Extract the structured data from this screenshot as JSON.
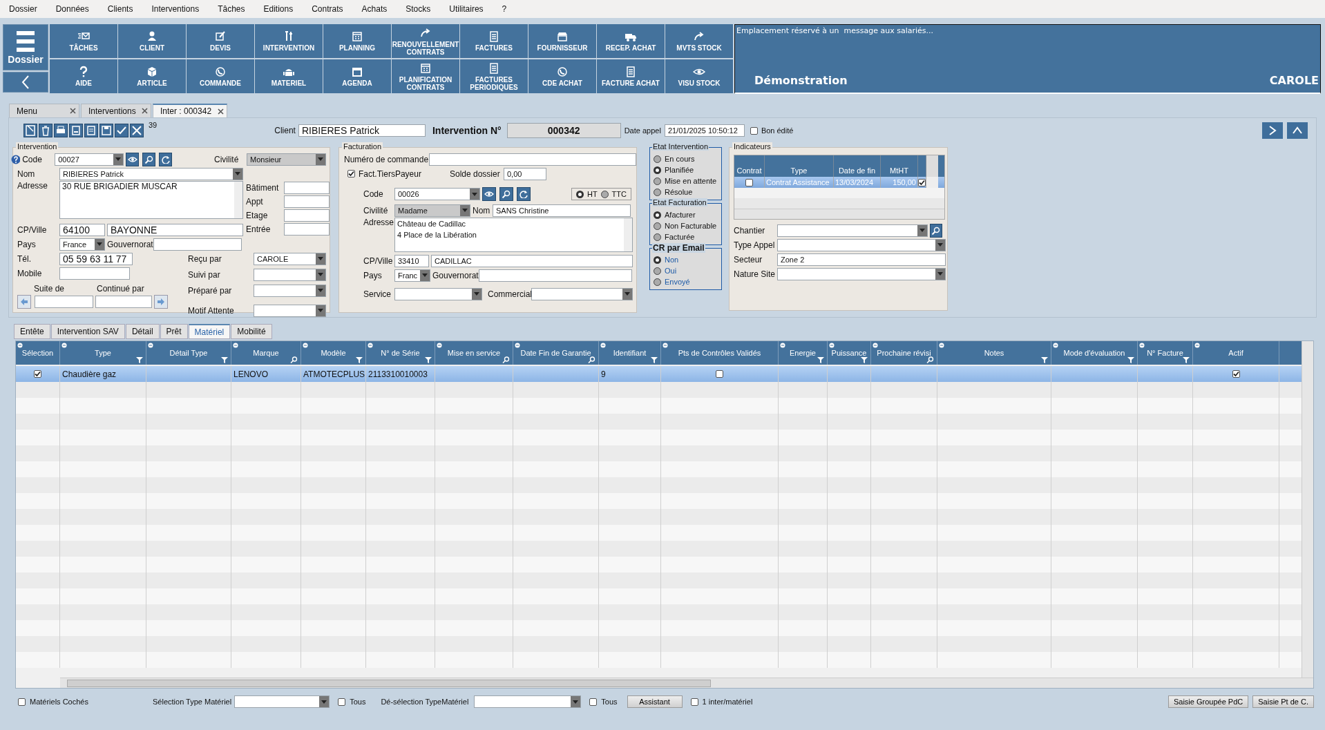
{
  "menu": [
    "Dossier",
    "Données",
    "Clients",
    "Interventions",
    "Tâches",
    "Editions",
    "Contrats",
    "Achats",
    "Stocks",
    "Utilitaires",
    "?"
  ],
  "toolbar": {
    "dossier": "Dossier",
    "rows": [
      [
        "TÂCHES",
        "CLIENT",
        "DEVIS",
        "INTERVENTION",
        "PLANNING",
        "RENOUVELLEMENT CONTRATS",
        "FACTURES",
        "FOURNISSEUR",
        "RECEP. ACHAT",
        "MVTS STOCK"
      ],
      [
        "AIDE",
        "ARTICLE",
        "COMMANDE",
        "MATERIEL",
        "AGENDA",
        "PLANIFICATION CONTRATS",
        "FACTURES PERIODIQUES",
        "CDE ACHAT",
        "FACTURE ACHAT",
        "VISU STOCK"
      ]
    ]
  },
  "message": {
    "text": "Emplacement réservé à un  message aux salariés...",
    "company": "Démonstration",
    "user": "CAROLE"
  },
  "doc_tabs": [
    {
      "label": "Menu",
      "selected": false
    },
    {
      "label": "Interventions",
      "selected": false
    },
    {
      "label": "Inter : 000342",
      "selected": true
    }
  ],
  "header": {
    "record_count": "39",
    "client_label": "Client",
    "client": "RIBIERES Patrick",
    "number_label": "Intervention N°",
    "number": "000342",
    "date_label": "Date appel",
    "date": "21/01/2025 10:50:12",
    "bon_edite": {
      "label": "Bon édité",
      "checked": false
    }
  },
  "intervention": {
    "title": "Intervention",
    "code_label": "Code",
    "code": "00027",
    "civilite_label": "Civilité",
    "civilite": "Monsieur",
    "nom_label": "Nom",
    "nom": "RIBIERES Patrick",
    "adresse_label": "Adresse",
    "adresse": "30 RUE BRIGADIER MUSCAR",
    "extra": [
      {
        "label": "Bâtiment"
      },
      {
        "label": "Appt"
      },
      {
        "label": "Etage"
      },
      {
        "label": "Entrée"
      }
    ],
    "cp_label": "CP/Ville",
    "cp": "64100",
    "ville": "BAYONNE",
    "pays_label": "Pays",
    "pays": "France",
    "gouvernorat_label": "Gouvernorat",
    "tel_label": "Tél.",
    "tel": "05 59 63 11 77",
    "mobile_label": "Mobile",
    "suite_label": "Suite de",
    "continue_label": "Continué par",
    "assign": [
      {
        "label": "Reçu par",
        "value": "CAROLE"
      },
      {
        "label": "Suivi par"
      },
      {
        "label": "Préparé par"
      },
      {
        "label": "Motif Attente"
      }
    ]
  },
  "facturation": {
    "title": "Facturation",
    "commande_label": "Numéro de commande",
    "tiers": {
      "label": "Fact.TiersPayeur",
      "checked": true
    },
    "solde_label": "Solde dossier",
    "solde": "0,00",
    "code_label": "Code",
    "code": "00026",
    "tax": [
      {
        "label": "HT",
        "selected": true
      },
      {
        "label": "TTC",
        "selected": false
      }
    ],
    "civilite_label": "Civilité",
    "civilite": "Madame",
    "nom_label": "Nom",
    "nom": "SANS Christine",
    "adresse_label": "Adresse",
    "adresse_lines": [
      "Château de Cadillac",
      "4 Place de la Libération"
    ],
    "cp_label": "CP/Ville",
    "cp": "33410",
    "ville": "CADILLAC",
    "pays_label": "Pays",
    "pays": "Franc",
    "gouvernorat_label": "Gouvernorat",
    "service_label": "Service",
    "commercial_label": "Commercial"
  },
  "states": [
    {
      "title": "Etat Intervention",
      "kind": "standard",
      "options": [
        {
          "label": "En cours",
          "selected": false
        },
        {
          "label": "Planifiée",
          "selected": true
        },
        {
          "label": "Mise en attente",
          "selected": false
        },
        {
          "label": "Résolue",
          "selected": false
        }
      ]
    },
    {
      "title": "Etat Facturation",
      "kind": "standard",
      "options": [
        {
          "label": "Afacturer",
          "selected": true
        },
        {
          "label": "Non Facturable",
          "selected": false
        },
        {
          "label": "Facturée",
          "selected": false
        }
      ]
    },
    {
      "title": "CR par Email",
      "kind": "highlight",
      "options": [
        {
          "label": "Non",
          "selected": true
        },
        {
          "label": "Oui",
          "selected": false
        },
        {
          "label": "Envoyé",
          "selected": false
        }
      ]
    }
  ],
  "indicateurs": {
    "title": "Indicateurs",
    "columns": [
      "Contrat",
      "Type",
      "Date de fin",
      "MtHT"
    ],
    "rows": [
      {
        "selected": true,
        "cells": [
          {
            "checked": false
          },
          {
            "text": "Contrat Assistance"
          },
          {
            "text": "13/03/2024"
          },
          {
            "text": "150,00"
          },
          {
            "checked": true
          }
        ]
      }
    ],
    "fields": [
      {
        "label": "Chantier",
        "kind": "search"
      },
      {
        "label": "Type Appel",
        "kind": "dropdown"
      },
      {
        "label": "Secteur",
        "kind": "text",
        "value": "Zone 2"
      },
      {
        "label": "Nature Site",
        "kind": "dropdown"
      }
    ]
  },
  "subtabs": [
    {
      "label": "Entête",
      "selected": false
    },
    {
      "label": "Intervention SAV",
      "selected": false
    },
    {
      "label": "Détail",
      "selected": false
    },
    {
      "label": "Prêt",
      "selected": false
    },
    {
      "label": "Matériel",
      "selected": true
    },
    {
      "label": "Mobilité",
      "selected": false
    }
  ],
  "materiel": {
    "columns": [
      {
        "label": "Sélection"
      },
      {
        "label": "Type",
        "kind": "funnel"
      },
      {
        "label": "Détail Type",
        "kind": "funnel"
      },
      {
        "label": "Marque",
        "kind": "search"
      },
      {
        "label": "Modèle",
        "kind": "funnel"
      },
      {
        "label": "N° de Série",
        "kind": "funnel"
      },
      {
        "label": "Mise en service",
        "kind": "search"
      },
      {
        "label": "Date Fin de Garantie",
        "kind": "search"
      },
      {
        "label": "Identifiant",
        "kind": "funnel"
      },
      {
        "label": "Pts de Contrôles Validés"
      },
      {
        "label": "Energie",
        "kind": "funnel"
      },
      {
        "label": "Puissance",
        "kind": "funnel"
      },
      {
        "label": "Prochaine révisi",
        "kind": "search"
      },
      {
        "label": "Notes",
        "kind": "funnel"
      },
      {
        "label": "Mode d'évaluation",
        "kind": "funnel"
      },
      {
        "label": "N° Facture",
        "kind": "funnel"
      },
      {
        "label": "Actif"
      }
    ],
    "rows": [
      {
        "selected": true,
        "selection": true,
        "type": "Chaudière gaz",
        "marque": "LENOVO",
        "modele": "ATMOTECPLUS",
        "serie": "2113310010003",
        "identifiant": "9",
        "pts_valides": false,
        "actif": true
      }
    ]
  },
  "bottom": {
    "materiels_coches": {
      "label": "Matériels Cochés",
      "checked": false
    },
    "selection_label": "Sélection Type Matériel",
    "tous_selection": {
      "label": "Tous",
      "checked": false
    },
    "deselection_label": "Dé-sélection TypeMatériel",
    "tous_deselection": {
      "label": "Tous",
      "checked": false
    },
    "assistant": "Assistant",
    "une_inter": {
      "label": "1 inter/matériel",
      "checked": false
    },
    "buttons": [
      "Saisie Groupée PdC",
      "Saisie Pt de C."
    ]
  }
}
